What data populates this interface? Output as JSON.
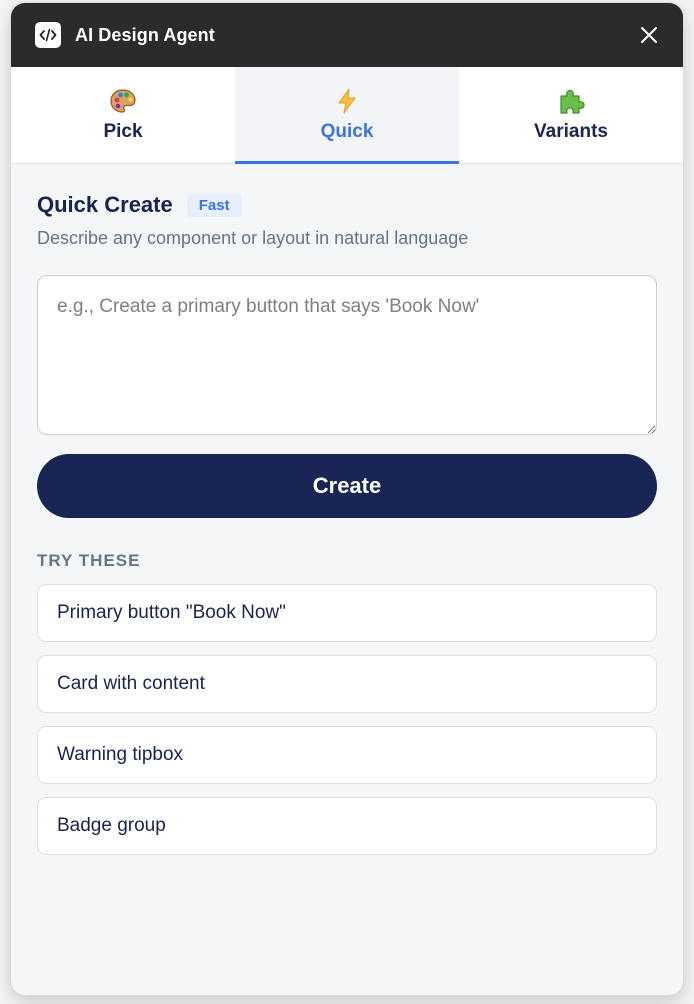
{
  "window": {
    "title": "AI Design Agent",
    "app_icon": "code-icon",
    "close_icon": "close-icon"
  },
  "tabs": [
    {
      "label": "Pick",
      "icon": "palette-icon",
      "active": false
    },
    {
      "label": "Quick",
      "icon": "lightning-icon",
      "active": true
    },
    {
      "label": "Variants",
      "icon": "puzzle-icon",
      "active": false
    }
  ],
  "main": {
    "heading": "Quick Create",
    "badge": "Fast",
    "subtitle": "Describe any component or layout in natural language",
    "prompt": {
      "value": "",
      "placeholder": "e.g., Create a primary button that says 'Book Now'"
    },
    "create_label": "Create",
    "try_label": "TRY THESE",
    "suggestions": [
      "Primary button \"Book Now\"",
      "Card with content",
      "Warning tipbox",
      "Badge group"
    ]
  },
  "colors": {
    "titlebar": "#2b2b2b",
    "accent": "#3b73e0",
    "primary_button": "#182555"
  }
}
